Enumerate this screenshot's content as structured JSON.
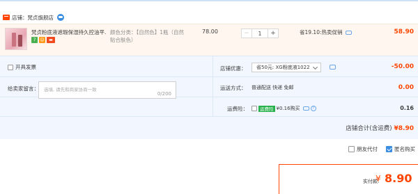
{
  "shop": {
    "label": "店铺：梵贞旗舰店"
  },
  "item": {
    "title": "梵贞粉底液遮瑕保湿持久控油平...",
    "badges": [
      "7",
      "☺",
      "▬"
    ],
    "spec_label": "颜色分类：【自然色】1瓶（自然贴合肤色）",
    "unit_price": "78.00",
    "quantity": "1",
    "minus": "−",
    "plus": "+",
    "promo": "省19.10:热卖促销",
    "subtotal": "58.90"
  },
  "extras": {
    "invoice_label": "开具发票",
    "message_label": "给卖家留言：",
    "message_placeholder": "选填, 请先和商家协商一致",
    "message_count": "0/200",
    "coupon_label": "店铺优惠：",
    "coupon_value": "省50元: XG粉底液1022",
    "coupon_amount": "-50.00",
    "shipping_label": "运送方式：",
    "shipping_value": "普通配送 快递 免邮",
    "shipping_amount": "0.00",
    "insurance_label": "运费险：",
    "insurance_tag": "运费险",
    "insurance_text": "¥0.16购买",
    "insurance_help": "?",
    "insurance_amount": "0.16",
    "total_label": "店铺合计(含运费)",
    "total_amount": "¥8.90"
  },
  "options": {
    "friend_pay": "朋友代付",
    "anonymous": "匿名购买"
  },
  "payment": {
    "label": "实付款:",
    "currency": "¥",
    "amount": "8.90"
  }
}
